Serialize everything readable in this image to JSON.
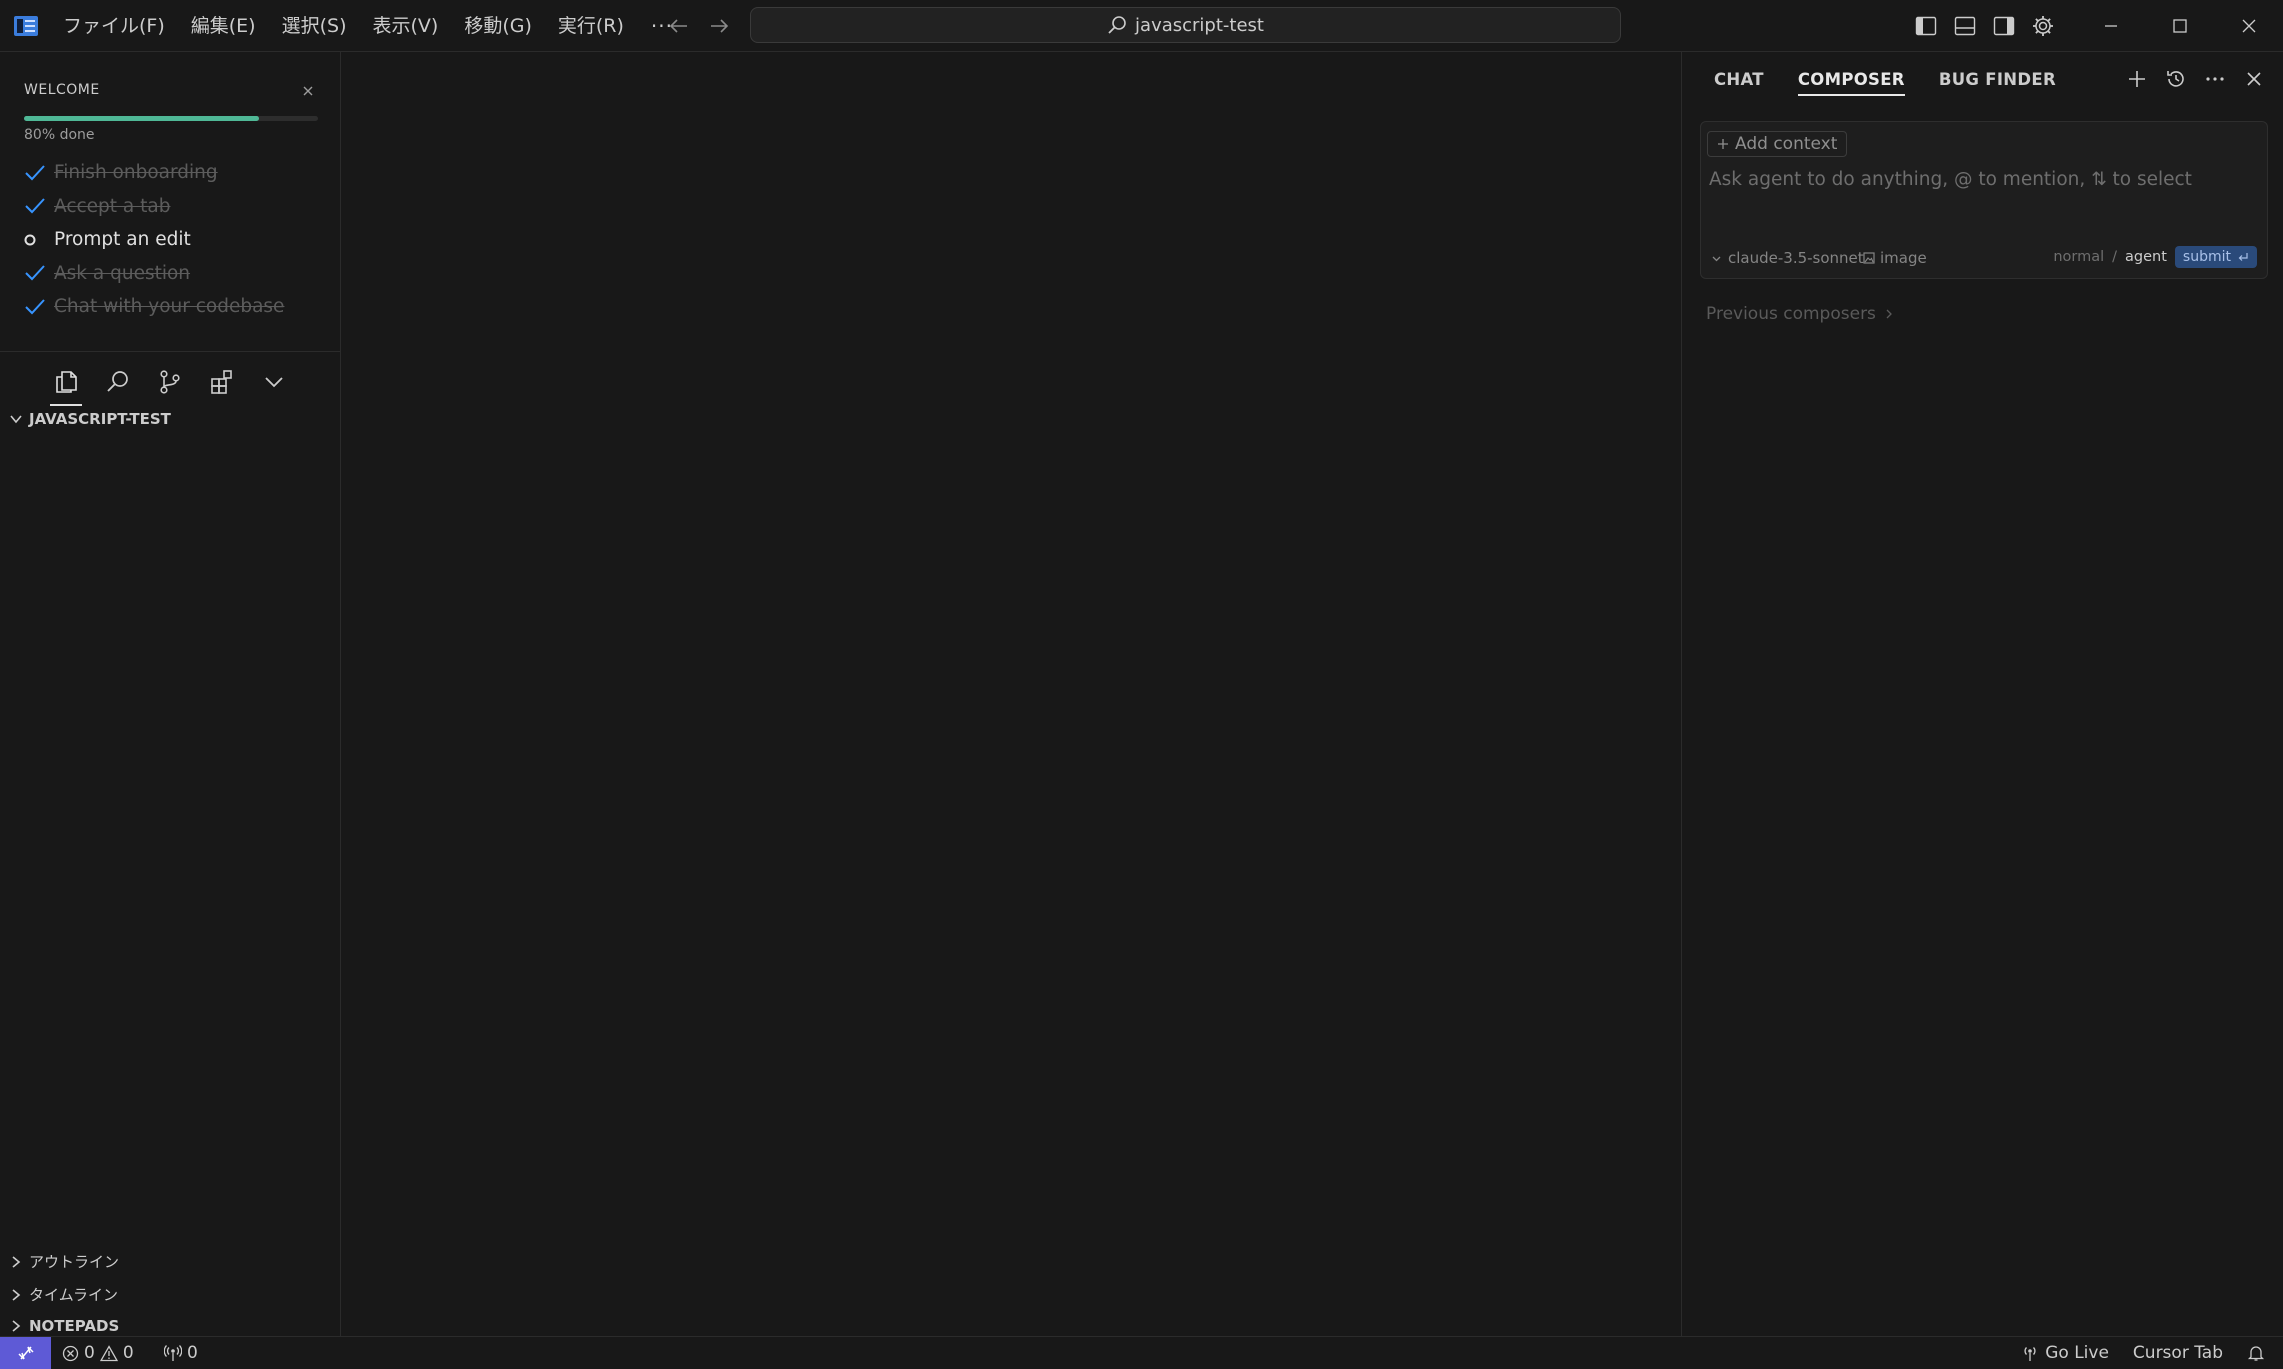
{
  "titlebar": {
    "menu": [
      "ファイル(F)",
      "編集(E)",
      "選択(S)",
      "表示(V)",
      "移動(G)",
      "実行(R)"
    ],
    "more": "···",
    "search_text": "javascript-test"
  },
  "welcome": {
    "title": "WELCOME",
    "progress": 0.8,
    "progress_text": "80% done",
    "items": [
      {
        "label": "Finish onboarding",
        "done": true
      },
      {
        "label": "Accept a tab",
        "done": true
      },
      {
        "label": "Prompt an edit",
        "done": false
      },
      {
        "label": "Ask a question",
        "done": true
      },
      {
        "label": "Chat with your codebase",
        "done": true
      }
    ]
  },
  "explorer": {
    "root": "JAVASCRIPT-TEST",
    "sections": [
      "アウトライン",
      "タイムライン",
      "NOTEPADS"
    ]
  },
  "panel": {
    "tabs": [
      "CHAT",
      "COMPOSER",
      "BUG FINDER"
    ],
    "active_tab": "COMPOSER",
    "add_context": "Add context",
    "input_placeholder": "Ask agent to do anything, @ to mention, ⇅ to select",
    "model": "claude-3.5-sonnet",
    "image_label": "image",
    "mode_normal": "normal",
    "mode_separator": "/",
    "mode_agent": "agent",
    "submit": "submit",
    "previous_composers": "Previous composers"
  },
  "statusbar": {
    "errors": "0",
    "warnings": "0",
    "ports": "0",
    "go_live": "Go Live",
    "cursor_tab": "Cursor Tab"
  },
  "colors": {
    "background": "#181818",
    "accent_progress": "#4fb896",
    "check_blue": "#3794ff",
    "remote_purple": "#5e5ad6",
    "submit_blue": "#2a4a7a"
  }
}
